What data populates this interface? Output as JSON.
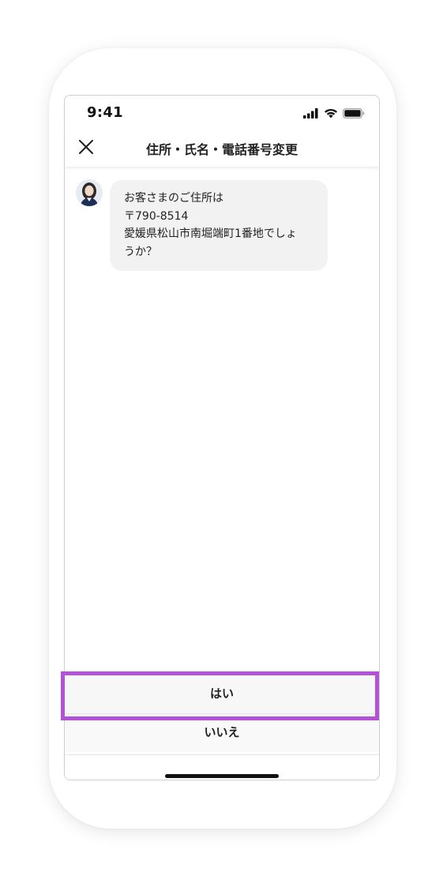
{
  "status_bar": {
    "time": "9:41",
    "icons": [
      "cellular-signal-icon",
      "wifi-icon",
      "battery-icon"
    ]
  },
  "header": {
    "title": "住所・氏名・電話番号変更",
    "close_icon": "close-icon"
  },
  "chat": {
    "avatar_icon": "operator-avatar",
    "message_lines": [
      "お客さまのご住所は",
      "〒790-8514",
      "愛媛県松山市南堀端町1番地でしょ",
      "うか？"
    ]
  },
  "answers": {
    "yes_label": "はい",
    "no_label": "いいえ"
  },
  "colors": {
    "highlight": "#b452d6",
    "bubble_bg": "#f2f2f2",
    "button_bg": "#f7f7f7"
  }
}
